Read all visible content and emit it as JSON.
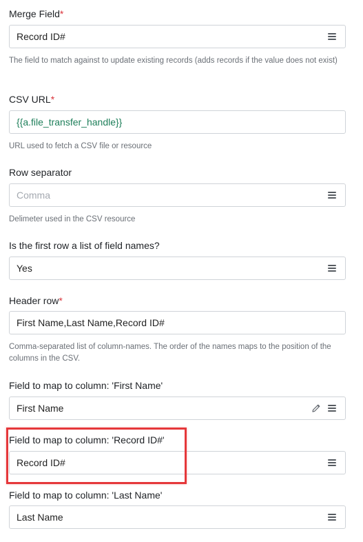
{
  "merge_field": {
    "label": "Merge Field",
    "required_mark": "*",
    "value": "Record ID#",
    "help": "The field to match against to update existing records (adds records if the value does not exist)"
  },
  "csv_url": {
    "label": "CSV URL",
    "required_mark": "*",
    "value": "{{a.file_transfer_handle}}",
    "help": "URL used to fetch a CSV file or resource"
  },
  "row_separator": {
    "label": "Row separator",
    "placeholder": "Comma",
    "help": "Delimeter used in the CSV resource"
  },
  "first_row_names": {
    "label": "Is the first row a list of field names?",
    "value": "Yes"
  },
  "header_row": {
    "label": "Header row",
    "required_mark": "*",
    "value": "First Name,Last Name,Record ID#",
    "help": "Comma-separated list of column-names. The order of the names maps to the position of the columns in the CSV."
  },
  "map_first_name": {
    "label": "Field to map to column: 'First Name'",
    "value": "First Name"
  },
  "map_record_id": {
    "label": "Field to map to column: 'Record ID#'",
    "value": "Record ID#"
  },
  "map_last_name": {
    "label": "Field to map to column: 'Last Name'",
    "value": "Last Name"
  },
  "colors": {
    "required": "#d9343b",
    "highlight": "#e5373a",
    "template_text": "#1e7f5a"
  }
}
